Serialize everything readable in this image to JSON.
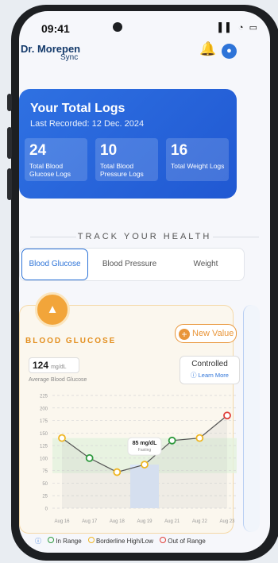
{
  "status_bar": {
    "time": "09:41",
    "icons": "▌▌ ◔ ▭"
  },
  "header": {
    "brand": "Dr. Morepen",
    "brand_sub": "Sync",
    "bell_icon": "🔔",
    "avatar_icon": "●"
  },
  "logs": {
    "title": "Your Total Logs",
    "last_recorded": "Last Recorded: 12 Dec. 2024",
    "stats": [
      {
        "value": "24",
        "label": "Total Blood Glucose Logs"
      },
      {
        "value": "10",
        "label": "Total Blood Pressure Logs"
      },
      {
        "value": "16",
        "label": "Total Weight Logs"
      }
    ]
  },
  "section_title": "TRACK YOUR HEALTH",
  "tabs": [
    "Blood Glucose",
    "Blood Pressure",
    "Weight"
  ],
  "glucose_card": {
    "title": "BLOOD GLUCOSE",
    "new_value": "New Value",
    "avg_value": "124",
    "avg_unit": "mg/dL",
    "avg_label": "Average Blood Glucose",
    "status": "Controlled",
    "learn_more": "ⓘ Learn More"
  },
  "chart_data": {
    "type": "line",
    "x": [
      "Aug 16",
      "Aug 17",
      "Aug 18",
      "Aug 19",
      "Aug 21",
      "Aug 22",
      "Aug 23"
    ],
    "y": [
      140,
      100,
      72,
      87,
      135,
      140,
      185
    ],
    "point_status": [
      "borderline",
      "in-range",
      "borderline",
      "borderline",
      "in-range",
      "borderline",
      "out-of-range"
    ],
    "ylim": [
      0,
      225
    ],
    "y_ticks": [
      "225",
      "200",
      "175",
      "150",
      "125",
      "100",
      "75",
      "50",
      "25",
      "0"
    ],
    "tooltip": {
      "value": "85 mg/dL",
      "label": "Fasting",
      "x": "Aug 19"
    },
    "in_range_band": [
      70,
      140
    ],
    "colors": {
      "line": "#555555",
      "in_range": "#2e9a3e",
      "borderline": "#efb623",
      "out_of_range": "#e0413b",
      "band": "#e3f1dd",
      "highlight": "#dbe7fb"
    }
  },
  "legend": {
    "info": "ⓘ",
    "in_range": "In Range",
    "borderline": "Borderline High/Low",
    "out_of_range": "Out of Range"
  }
}
